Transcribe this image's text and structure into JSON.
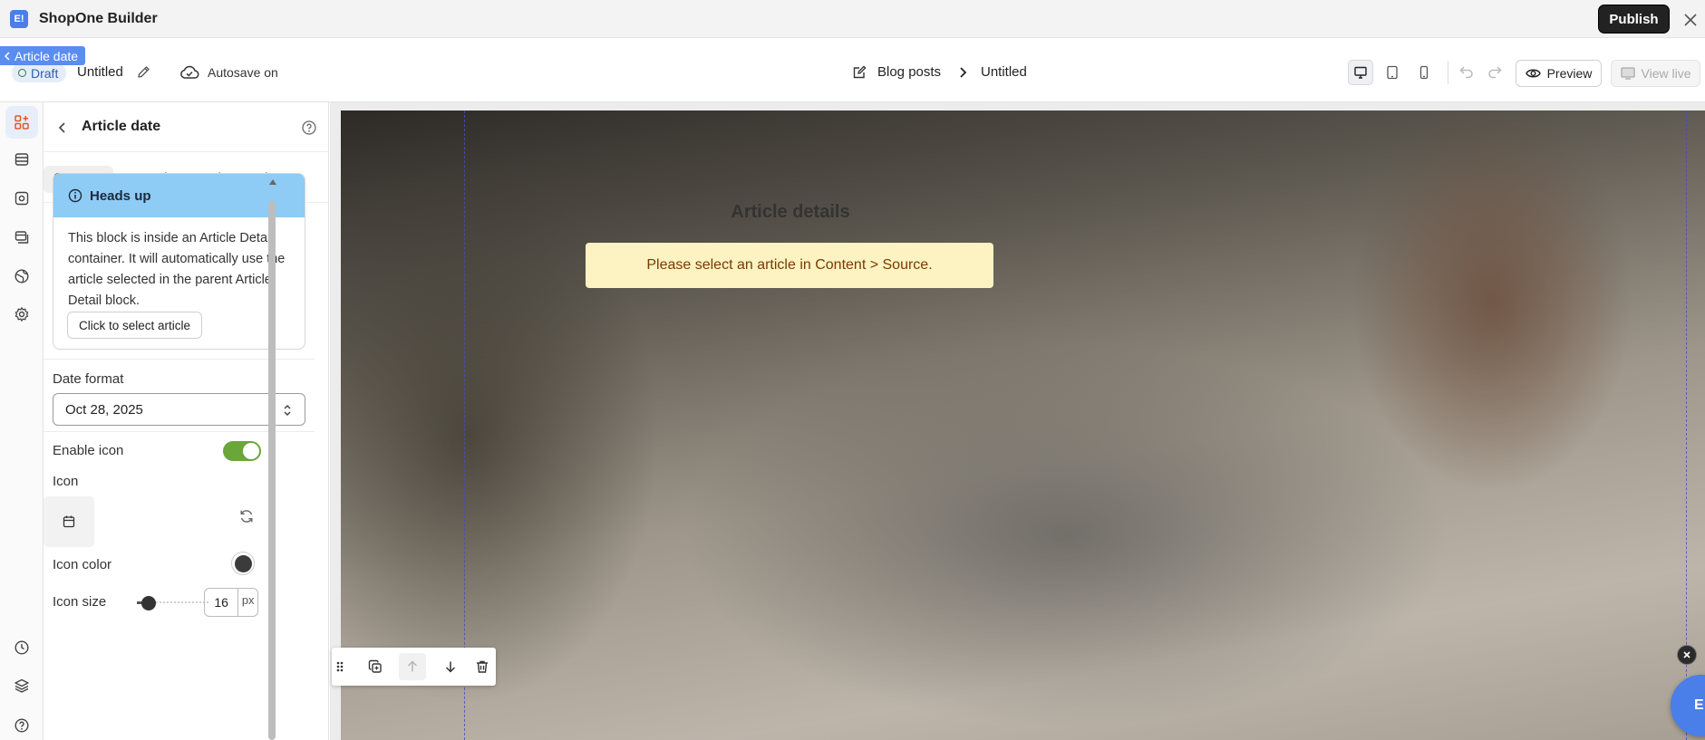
{
  "app": {
    "logo_text": "E!",
    "title": "ShopOne Builder"
  },
  "topbar": {
    "publish_label": "Publish"
  },
  "selection_tag": "Article date",
  "doc": {
    "status": "Draft",
    "name": "Untitled",
    "autosave": "Autosave on"
  },
  "breadcrumb": {
    "parent": "Blog posts",
    "current": "Untitled"
  },
  "toolbar": {
    "preview_label": "Preview",
    "view_live_label": "View live"
  },
  "panel": {
    "title": "Article date",
    "tabs": [
      {
        "label": "Content",
        "active": true
      },
      {
        "label": "Basic",
        "active": false
      },
      {
        "label": "Advanced",
        "active": false
      }
    ],
    "notice": {
      "title": "Heads up",
      "body": "This block is inside an Article Detail container. It will automatically use the article selected in the parent Article Detail block.",
      "button_label": "Click to select article"
    },
    "date_format": {
      "label": "Date format",
      "value": "Oct 28, 2025"
    },
    "enable_icon": {
      "label": "Enable icon",
      "enabled": true
    },
    "icon": {
      "label": "Icon",
      "name": "calendar-icon"
    },
    "icon_color": {
      "label": "Icon color",
      "value": "#3b3b3b"
    },
    "icon_size": {
      "label": "Icon size",
      "value": "16",
      "unit": "px"
    }
  },
  "canvas": {
    "heading": "Article details",
    "warning": "Please select an article in Content > Source."
  },
  "fab": {
    "logo_text": "E!"
  },
  "colors": {
    "accent": "#4a7ee8",
    "toggle_on": "#6aa63a",
    "notice_header": "#8ecbf5",
    "warning_bg": "#fdf2c2",
    "warning_text": "#7a3a00"
  }
}
